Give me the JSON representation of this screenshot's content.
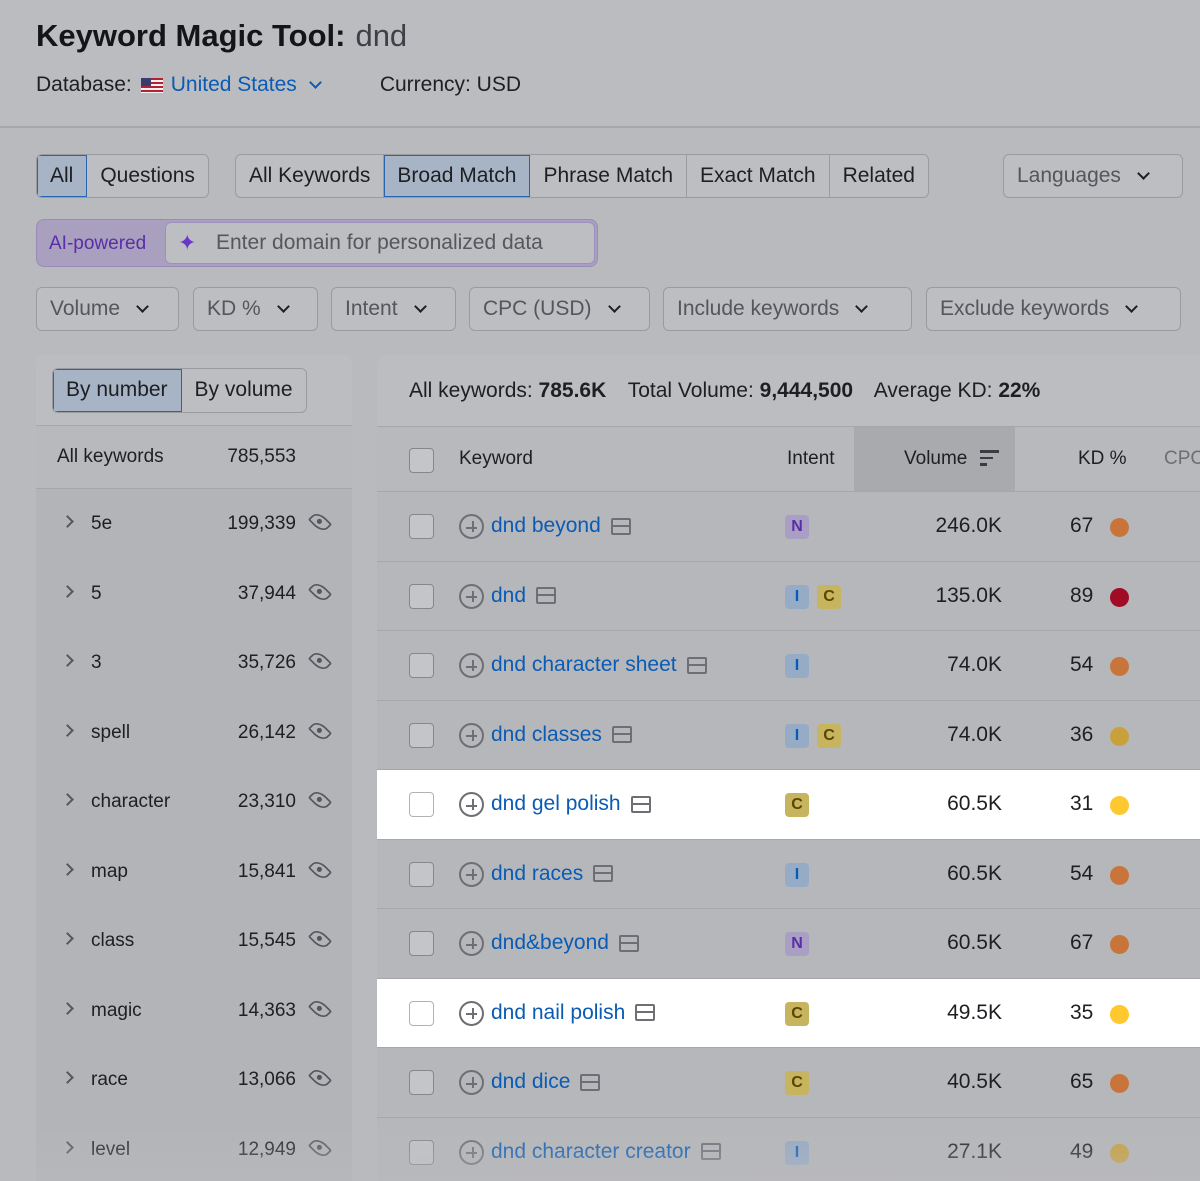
{
  "header": {
    "title": "Keyword Magic Tool:",
    "query": "dnd",
    "database_label": "Database:",
    "database_value": "United States",
    "currency": "Currency: USD"
  },
  "tabs_scope": [
    "All",
    "Questions"
  ],
  "tabs_match": [
    "All Keywords",
    "Broad Match",
    "Phrase Match",
    "Exact Match",
    "Related"
  ],
  "languages": "Languages",
  "ai": {
    "label": "AI-powered",
    "placeholder": "Enter domain for personalized data"
  },
  "filters": [
    "Volume",
    "KD %",
    "Intent",
    "CPC (USD)",
    "Include keywords",
    "Exclude keywords"
  ],
  "left": {
    "toggle": [
      "By number",
      "By volume"
    ],
    "header_label": "All keywords",
    "header_count": "785,553",
    "groups": [
      {
        "name": "5e",
        "count": "199,339"
      },
      {
        "name": "5",
        "count": "37,944"
      },
      {
        "name": "3",
        "count": "35,726"
      },
      {
        "name": "spell",
        "count": "26,142"
      },
      {
        "name": "character",
        "count": "23,310"
      },
      {
        "name": "map",
        "count": "15,841"
      },
      {
        "name": "class",
        "count": "15,545"
      },
      {
        "name": "magic",
        "count": "14,363"
      },
      {
        "name": "race",
        "count": "13,066"
      },
      {
        "name": "level",
        "count": "12,949"
      }
    ]
  },
  "summary": {
    "all_label": "All keywords:",
    "all_value": "785.6K",
    "vol_label": "Total Volume:",
    "vol_value": "9,444,500",
    "kd_label": "Average KD:",
    "kd_value": "22%"
  },
  "columns": {
    "keyword": "Keyword",
    "intent": "Intent",
    "volume": "Volume",
    "kd": "KD %",
    "cpc": "CPC"
  },
  "intent_colors": {
    "N": {
      "bg": "#a99ec4",
      "fg": "#5a2ea6"
    },
    "I": {
      "bg": "#95abc6",
      "fg": "#0a5bb5"
    },
    "C": {
      "bg": "#c7b45e",
      "fg": "#5a4600"
    }
  },
  "rows": [
    {
      "keyword": "dnd beyond",
      "intents": [
        "N"
      ],
      "volume": "246.0K",
      "kd": "67",
      "kd_color": "#c8753b",
      "highlight": false
    },
    {
      "keyword": "dnd",
      "intents": [
        "I",
        "C"
      ],
      "volume": "135.0K",
      "kd": "89",
      "kd_color": "#a10c25",
      "highlight": false
    },
    {
      "keyword": "dnd character sheet",
      "intents": [
        "I"
      ],
      "volume": "74.0K",
      "kd": "54",
      "kd_color": "#c8753b",
      "highlight": false
    },
    {
      "keyword": "dnd classes",
      "intents": [
        "I",
        "C"
      ],
      "volume": "74.0K",
      "kd": "36",
      "kd_color": "#c8a13b",
      "highlight": false
    },
    {
      "keyword": "dnd gel polish",
      "intents": [
        "C"
      ],
      "volume": "60.5K",
      "kd": "31",
      "kd_color": "#ffc82e",
      "highlight": true
    },
    {
      "keyword": "dnd races",
      "intents": [
        "I"
      ],
      "volume": "60.5K",
      "kd": "54",
      "kd_color": "#c8753b",
      "highlight": false
    },
    {
      "keyword": "dnd&beyond",
      "intents": [
        "N"
      ],
      "volume": "60.5K",
      "kd": "67",
      "kd_color": "#c8753b",
      "highlight": false
    },
    {
      "keyword": "dnd nail polish",
      "intents": [
        "C"
      ],
      "volume": "49.5K",
      "kd": "35",
      "kd_color": "#ffc82e",
      "highlight": true
    },
    {
      "keyword": "dnd dice",
      "intents": [
        "C"
      ],
      "volume": "40.5K",
      "kd": "65",
      "kd_color": "#c8753b",
      "highlight": false
    },
    {
      "keyword": "dnd character creator",
      "intents": [
        "I"
      ],
      "volume": "27.1K",
      "kd": "49",
      "kd_color": "#c8a13b",
      "highlight": false
    }
  ]
}
